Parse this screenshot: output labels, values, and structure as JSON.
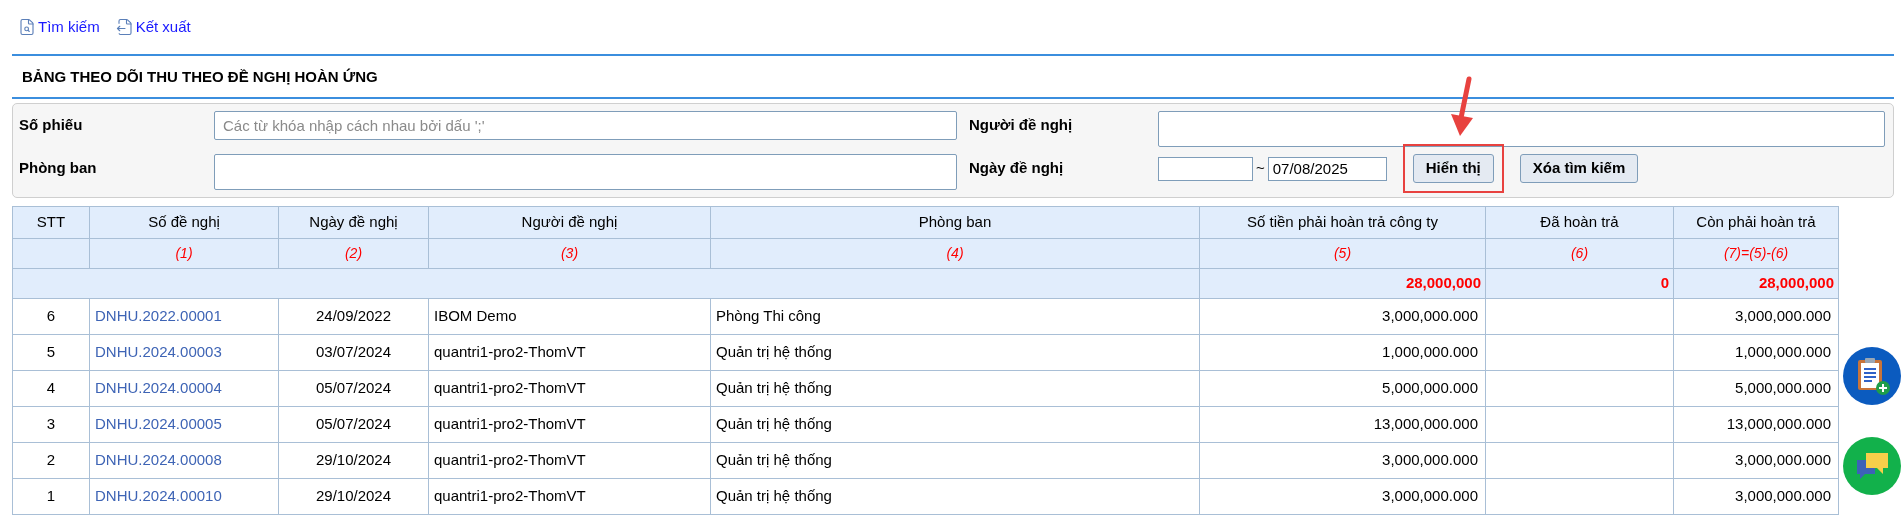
{
  "toolbar": [
    {
      "label": "Tìm kiếm",
      "kind": "search"
    },
    {
      "label": "Kết xuất",
      "kind": "export"
    }
  ],
  "title": "BẢNG THEO DÕI THU THEO ĐỀ NGHỊ HOÀN ỨNG",
  "filters": {
    "so_phieu": {
      "label": "Số phiếu",
      "placeholder": "Các từ khóa nhập cách nhau bởi dấu ';'"
    },
    "nguoi_de_nghi": {
      "label": "Người đề nghị"
    },
    "phong_ban": {
      "label": "Phòng ban"
    },
    "ngay_de_nghi": {
      "label": "Ngày đề nghị",
      "separator": "~",
      "to": "07/08/2025"
    }
  },
  "buttons": [
    {
      "label": "Hiển thị",
      "highlighted": true
    },
    {
      "label": "Xóa tìm kiếm",
      "highlighted": false
    }
  ],
  "table": {
    "columns": [
      "STT",
      "Số đề nghị",
      "Ngày đề nghị",
      "Người đề nghị",
      "Phòng ban",
      "Số tiền phải hoàn trả công ty",
      "Đã hoàn trả",
      "Còn phải hoàn trả"
    ],
    "column_numbers": [
      "(1)",
      "(2)",
      "(3)",
      "(4)",
      "(5)",
      "(6)",
      "(7)=(5)-(6)"
    ],
    "totals": {
      "amount": "28,000,000",
      "paid": "0",
      "remaining": "28,000,000"
    },
    "rows": [
      {
        "stt": "6",
        "so": "DNHU.2022.00001",
        "ngay": "24/09/2022",
        "nguoi": "IBOM Demo",
        "phong": "Phòng Thi công",
        "amount": "3,000,000.000",
        "remaining": "3,000,000.000"
      },
      {
        "stt": "5",
        "so": "DNHU.2024.00003",
        "ngay": "03/07/2024",
        "nguoi": "quantri1-pro2-ThomVT",
        "phong": "Quản trị hệ thống",
        "amount": "1,000,000.000",
        "remaining": "1,000,000.000"
      },
      {
        "stt": "4",
        "so": "DNHU.2024.00004",
        "ngay": "05/07/2024",
        "nguoi": "quantri1-pro2-ThomVT",
        "phong": "Quản trị hệ thống",
        "amount": "5,000,000.000",
        "remaining": "5,000,000.000"
      },
      {
        "stt": "3",
        "so": "DNHU.2024.00005",
        "ngay": "05/07/2024",
        "nguoi": "quantri1-pro2-ThomVT",
        "phong": "Quản trị hệ thống",
        "amount": "13,000,000.000",
        "remaining": "13,000,000.000"
      },
      {
        "stt": "2",
        "so": "DNHU.2024.00008",
        "ngay": "29/10/2024",
        "nguoi": "quantri1-pro2-ThomVT",
        "phong": "Quản trị hệ thống",
        "amount": "3,000,000.000",
        "remaining": "3,000,000.000"
      },
      {
        "stt": "1",
        "so": "DNHU.2024.00010",
        "ngay": "29/10/2024",
        "nguoi": "quantri1-pro2-ThomVT",
        "phong": "Quản trị hệ thống",
        "amount": "3,000,000.000",
        "remaining": "3,000,000.000"
      }
    ]
  }
}
